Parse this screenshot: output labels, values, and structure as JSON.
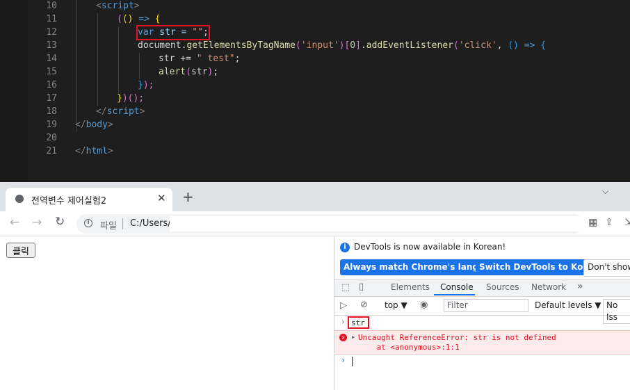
{
  "editor": {
    "lines": [
      {
        "n": "10",
        "tokens": [
          {
            "t": "<",
            "c": "tag"
          },
          {
            "t": "script",
            "c": "tagname"
          },
          {
            "t": ">",
            "c": "tag"
          }
        ]
      },
      {
        "n": "11",
        "tokens": [
          {
            "t": "(",
            "c": "br1"
          },
          {
            "t": "()",
            "c": "br2"
          },
          {
            "t": " => ",
            "c": "key"
          },
          {
            "t": "{",
            "c": "br2"
          }
        ]
      },
      {
        "n": "12",
        "tokens": [
          {
            "t": "var",
            "c": "key"
          },
          {
            "t": " str = ",
            "c": "var"
          },
          {
            "t": "\"\"",
            "c": "str"
          },
          {
            "t": ";",
            "c": "pun"
          }
        ]
      },
      {
        "n": "13",
        "tokens": [
          {
            "t": "document.",
            "c": "pun"
          },
          {
            "t": "getElementsByTagName",
            "c": "fn"
          },
          {
            "t": "(",
            "c": "br1"
          },
          {
            "t": "'input'",
            "c": "str"
          },
          {
            "t": ")",
            "c": "br1"
          },
          {
            "t": "[",
            "c": "br1"
          },
          {
            "t": "0",
            "c": "num"
          },
          {
            "t": "]",
            "c": "br1"
          },
          {
            "t": ".",
            "c": "pun"
          },
          {
            "t": "addEventListener",
            "c": "fn"
          },
          {
            "t": "(",
            "c": "br1"
          },
          {
            "t": "'click'",
            "c": "str"
          },
          {
            "t": ", ",
            "c": "pun"
          },
          {
            "t": "()",
            "c": "br3"
          },
          {
            "t": " => ",
            "c": "key"
          },
          {
            "t": "{",
            "c": "br3"
          }
        ]
      },
      {
        "n": "14",
        "tokens": [
          {
            "t": "str += ",
            "c": "pun"
          },
          {
            "t": "\" test\"",
            "c": "str"
          },
          {
            "t": ";",
            "c": "pun"
          }
        ]
      },
      {
        "n": "15",
        "tokens": [
          {
            "t": "alert",
            "c": "fn"
          },
          {
            "t": "(",
            "c": "br1"
          },
          {
            "t": "str",
            "c": "pun"
          },
          {
            "t": ")",
            "c": "br1"
          },
          {
            "t": ";",
            "c": "pun"
          }
        ]
      },
      {
        "n": "16",
        "tokens": [
          {
            "t": "}",
            "c": "br3"
          },
          {
            "t": ");",
            "c": "br1"
          }
        ]
      },
      {
        "n": "17",
        "tokens": [
          {
            "t": "}",
            "c": "br2"
          },
          {
            "t": ")",
            "c": "br1"
          },
          {
            "t": "();",
            "c": "br1"
          }
        ]
      },
      {
        "n": "18",
        "tokens": [
          {
            "t": "</",
            "c": "tag"
          },
          {
            "t": "script",
            "c": "tagname"
          },
          {
            "t": ">",
            "c": "tag"
          }
        ]
      },
      {
        "n": "19",
        "tokens": [
          {
            "t": "</",
            "c": "tag"
          },
          {
            "t": "body",
            "c": "tagname"
          },
          {
            "t": ">",
            "c": "tag"
          }
        ]
      },
      {
        "n": "20",
        "tokens": []
      },
      {
        "n": "21",
        "tokens": [
          {
            "t": "</",
            "c": "tag"
          },
          {
            "t": "html",
            "c": "tagname"
          },
          {
            "t": ">",
            "c": "tag"
          }
        ]
      }
    ]
  },
  "browser": {
    "tab_title": "전역변수 제어실험2",
    "tab_close": "✕",
    "new_tab": "+",
    "tab_menu": "⌵",
    "nav_back": "←",
    "nav_forward": "→",
    "nav_reload": "↻",
    "omnibox_scheme": "파일",
    "omnibox_url": "C:/Users/",
    "omnibox_info": "i"
  },
  "page": {
    "button_label": "클릭"
  },
  "devtools": {
    "banner_text": "DevTools is now available in Korean!",
    "banner_btn_match": "Always match Chrome's language",
    "banner_btn_switch": "Switch DevTools to Korean",
    "banner_btn_dont": "Don't show",
    "tabs": [
      "Elements",
      "Console",
      "Sources",
      "Network"
    ],
    "more_tabs": "»",
    "context": "top ▼",
    "filter_placeholder": "Filter",
    "levels": "Default levels ▼",
    "issues": "No Iss",
    "console_input": "str",
    "error_message": "Uncaught ReferenceError: str is not defined",
    "error_location": "    at <anonymous>:1:1",
    "prompt": "›",
    "input_chevron": "›"
  },
  "colors": {
    "accent": "#1a73e8",
    "error": "#e81123",
    "highlight_box": "#e81123",
    "editor_bg": "#1e1e1e"
  }
}
